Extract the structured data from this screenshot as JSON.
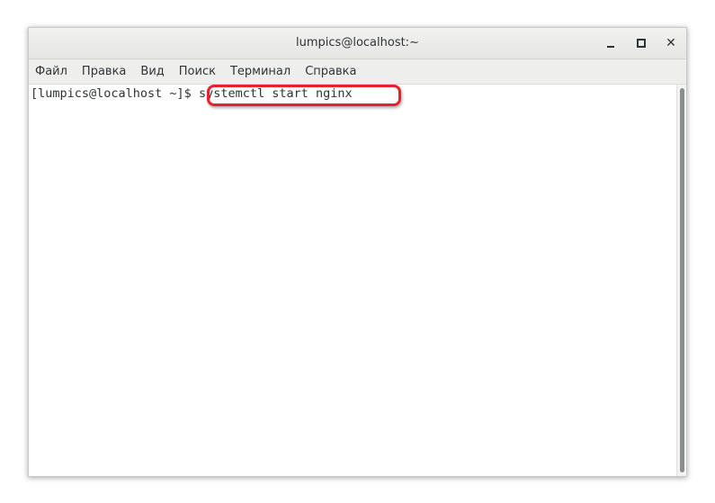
{
  "window": {
    "title": "lumpics@localhost:~"
  },
  "menu": {
    "items": [
      "Файл",
      "Правка",
      "Вид",
      "Поиск",
      "Терминал",
      "Справка"
    ]
  },
  "terminal": {
    "prompt": "[lumpics@localhost ~]$ ",
    "command": "systemctl start nginx"
  },
  "colors": {
    "highlight": "#e8202a",
    "titlebar": "#e6e6e5",
    "text": "#2e3436"
  },
  "icons": {
    "minimize": "minimize-icon",
    "maximize": "maximize-icon",
    "close": "close-icon"
  }
}
